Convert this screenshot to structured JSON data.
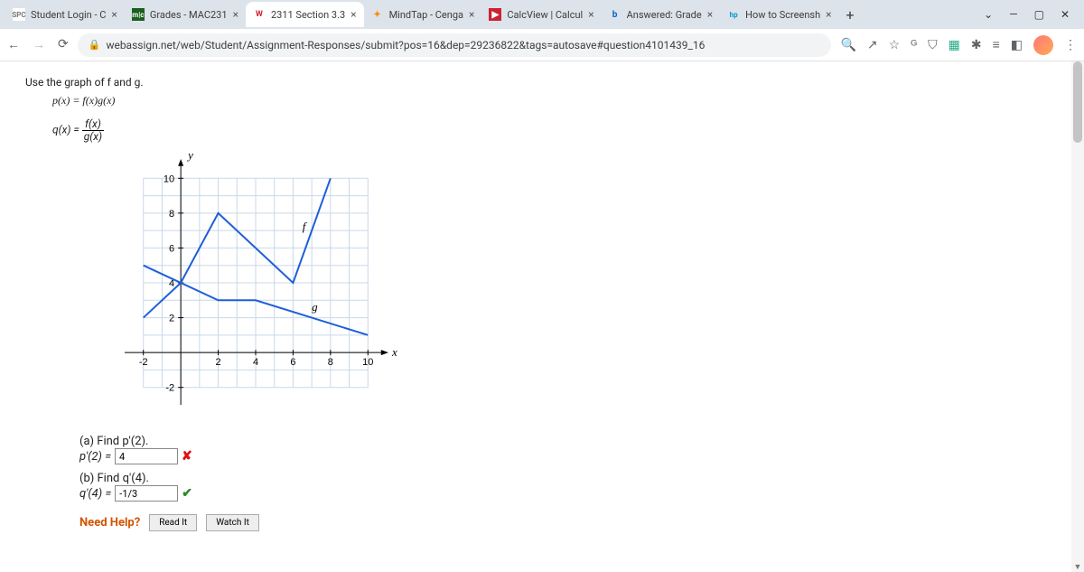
{
  "tabs": [
    {
      "title": "Student Login - C",
      "favicon_text": "SPC",
      "favicon_bg": "#fff",
      "favicon_color": "#777"
    },
    {
      "title": "Grades - MAC231",
      "favicon_text": "m|c",
      "favicon_bg": "#1a5f1a",
      "favicon_color": "#fff"
    },
    {
      "title": "2311 Section 3.3",
      "favicon_text": "W",
      "favicon_bg": "#fff",
      "favicon_color": "#c23"
    },
    {
      "title": "MindTap - Cenga",
      "favicon_text": "✦",
      "favicon_bg": "#fff",
      "favicon_color": "#f80"
    },
    {
      "title": "CalcView | Calcul",
      "favicon_text": "▶",
      "favicon_bg": "#c23",
      "favicon_color": "#fff"
    },
    {
      "title": "Answered: Grade",
      "favicon_text": "b",
      "favicon_bg": "#fff",
      "favicon_color": "#06c"
    },
    {
      "title": "How to Screensh",
      "favicon_text": "hp",
      "favicon_bg": "#fff",
      "favicon_color": "#09c"
    }
  ],
  "active_tab_index": 2,
  "url": "webassign.net/web/Student/Assignment-Responses/submit?pos=16&dep=29236822&tags=autosave#question4101439_16",
  "problem": {
    "prompt": "Use the graph of f and g.",
    "eq1": "p(x) = f(x)g(x)",
    "eq2_lhs": "q(x) = ",
    "eq2_num": "f(x)",
    "eq2_den": "g(x)",
    "partA_label": "(a) Find p′(2).",
    "partA_lhs": "p′(2) = ",
    "partA_value": "4",
    "partB_label": "(b) Find q′(4).",
    "partB_lhs": "q′(4) = ",
    "partB_value": "-1/3",
    "need_help": "Need Help?",
    "read_it": "Read It",
    "watch_it": "Watch It"
  },
  "chart_data": {
    "type": "line",
    "xlabel": "x",
    "ylabel": "y",
    "xlim": [
      -3,
      11
    ],
    "ylim": [
      -3,
      11
    ],
    "xticks": [
      -2,
      2,
      4,
      6,
      8,
      10
    ],
    "yticks": [
      -2,
      2,
      4,
      6,
      8,
      10
    ],
    "series": [
      {
        "name": "f",
        "label_pos": [
          6.5,
          7
        ],
        "points": [
          [
            -2,
            2
          ],
          [
            0,
            4
          ],
          [
            2,
            8
          ],
          [
            6,
            4
          ],
          [
            8,
            10
          ]
        ]
      },
      {
        "name": "g",
        "label_pos": [
          7,
          2.4
        ],
        "points": [
          [
            -2,
            5
          ],
          [
            2,
            3
          ],
          [
            4,
            3
          ],
          [
            10,
            1
          ]
        ]
      }
    ]
  }
}
